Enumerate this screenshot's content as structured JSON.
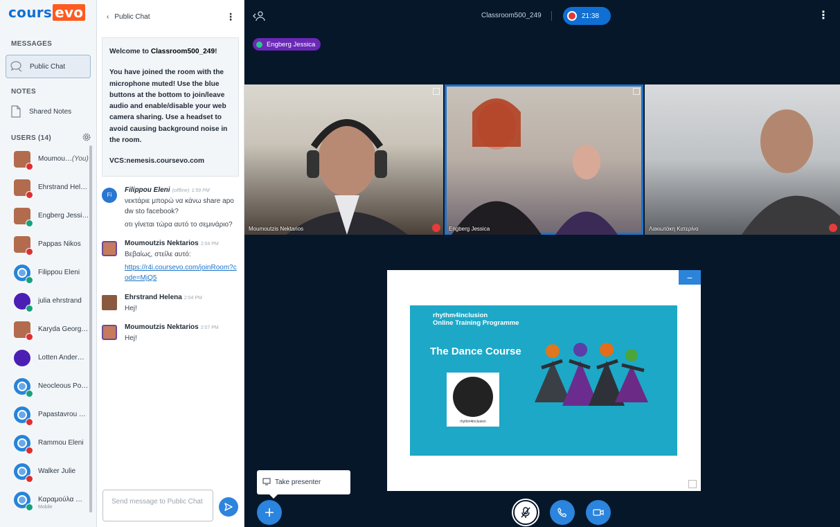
{
  "app": {
    "brand_a": "cours",
    "brand_b": "evo"
  },
  "sidebar": {
    "messages_title": "MESSAGES",
    "public_chat": "Public Chat",
    "notes_title": "NOTES",
    "shared_notes": "Shared Notes",
    "users_title": "USERS (14)",
    "users": [
      {
        "name": "Moumou…",
        "suffix": "(You)",
        "status": "red",
        "kind": "photo"
      },
      {
        "name": "Ehrstrand Hel…",
        "status": "red",
        "kind": "photo"
      },
      {
        "name": "Engberg Jessi…",
        "status": "green",
        "kind": "photo"
      },
      {
        "name": "Pappas Nikos",
        "status": "red",
        "kind": "photo"
      },
      {
        "name": "Filippou Eleni",
        "status": "green",
        "kind": "default"
      },
      {
        "name": "julia ehrstrand",
        "status": "green",
        "kind": "purple"
      },
      {
        "name": "Karyda Georg…",
        "status": "red",
        "kind": "photo"
      },
      {
        "name": "Lotten Ander…",
        "status": "",
        "kind": "purple"
      },
      {
        "name": "Neocleous Po…",
        "status": "green",
        "kind": "default"
      },
      {
        "name": "Papastavrou …",
        "status": "red",
        "kind": "default"
      },
      {
        "name": "Rammou Eleni",
        "status": "red",
        "kind": "default"
      },
      {
        "name": "Walker Julie",
        "status": "red",
        "kind": "default"
      },
      {
        "name": "Καραμούλα …",
        "sub": "Mobile",
        "status": "green",
        "kind": "default"
      }
    ]
  },
  "chat": {
    "back_label": "Public Chat",
    "welcome_prefix": "Welcome to ",
    "room": "Classroom500_249",
    "welcome_suffix": "!",
    "welcome_body": "You have joined the room with the microphone muted! Use the blue buttons at the bottom to join/leave audio and enable/disable your web camera sharing. Use a headset to avoid causing background noise in the room.",
    "vcs": "VCS:nemesis.coursevo.com",
    "messages": [
      {
        "author": "Filippou Eleni",
        "offline": "(offline)",
        "time": "1:59 PM",
        "initials": "Fi",
        "lines": [
          "νεκτάριε μπορώ να κάνω share apo dw sto facebook?",
          "οτι γίνεται τώρα αυτό το σεμινάριο?"
        ]
      },
      {
        "author": "Moumoutzis Nektarios",
        "time": "2:04 PM",
        "lines": [
          "Βεβαίως, στείλε αυτό:"
        ],
        "link": "https://r4i.coursevo.com/joinRoom?code=MjQ5"
      },
      {
        "author": "Ehrstrand Helena",
        "time": "2:04 PM",
        "lines": [
          "Hej!"
        ]
      },
      {
        "author": "Moumoutzis Nektarios",
        "time": "2:07 PM",
        "lines": [
          "Hej!"
        ]
      }
    ],
    "placeholder": "Send message to Public Chat"
  },
  "main": {
    "room_title": "Classroom500_249",
    "rec_time": "21:38",
    "talking": "Engberg Jessica",
    "videos": [
      {
        "label": "Moumoutzis Nektarios"
      },
      {
        "label": "Engberg Jessica"
      },
      {
        "label": "Λακιωτάκη Κατερίνα"
      }
    ],
    "slide": {
      "line1": "rhythm4inclusion",
      "line2": "Online Training Programme",
      "title": "The Dance Course",
      "badge": "rhythm4inclusion"
    },
    "minimize": "−",
    "tooltip": "Take presenter"
  },
  "colors": {
    "accent": "#2b84dd",
    "background": "#06172a"
  }
}
